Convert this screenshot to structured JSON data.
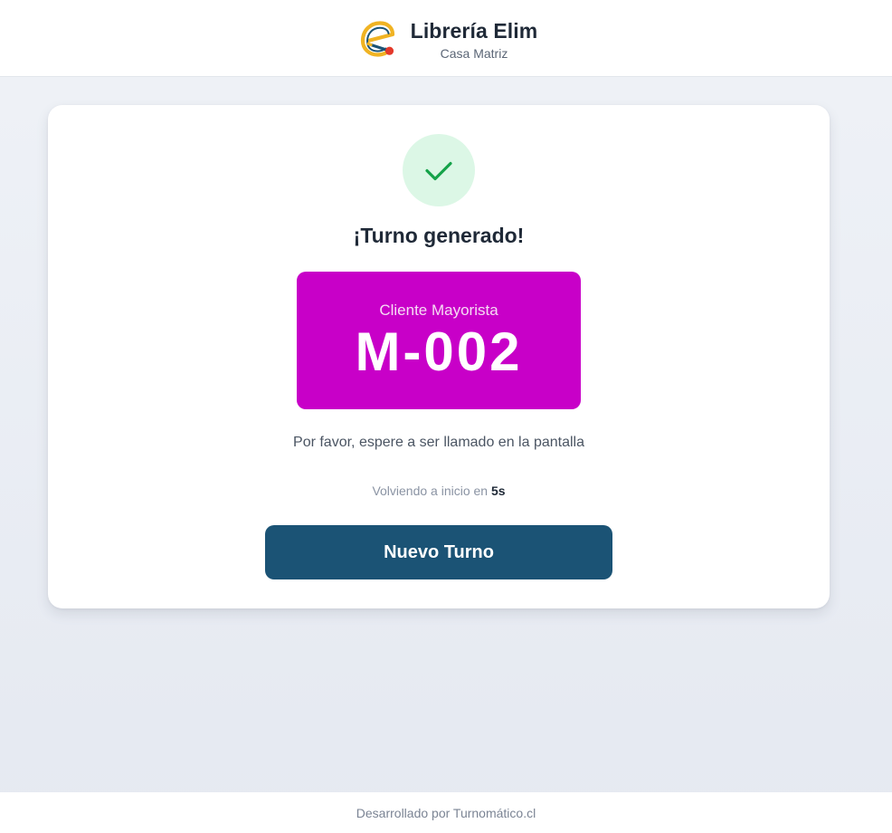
{
  "header": {
    "brand_name": "Librería Elim",
    "branch": "Casa Matriz",
    "logo_icon": "pencil-e-logo-icon"
  },
  "confirmation": {
    "status_icon": "checkmark-icon",
    "title": "¡Turno generado!",
    "ticket": {
      "category": "Cliente Mayorista",
      "number": "M-002",
      "color": "#c800c8"
    },
    "instructions": "Por favor, espere a ser llamado en la pantalla",
    "countdown_prefix": "Volviendo a inicio en ",
    "countdown_value": "5s",
    "new_ticket_button": "Nuevo Turno"
  },
  "footer": {
    "credit": "Desarrollado por Turnomático.cl"
  },
  "colors": {
    "primary": "#1b5375",
    "success": "#16a34a",
    "success_bg": "#dcf7e6"
  }
}
